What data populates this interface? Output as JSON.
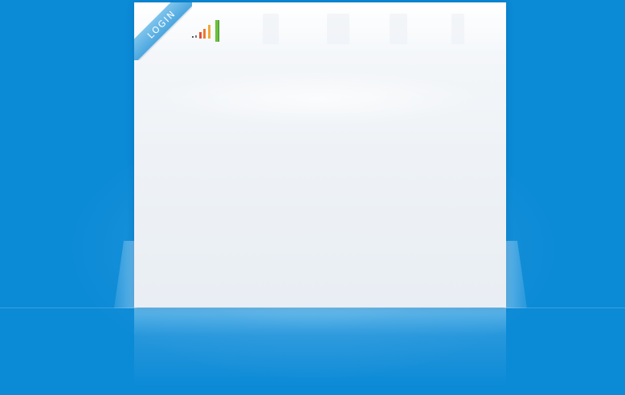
{
  "page": {
    "ribbon_label": "LOGIN"
  },
  "colors": {
    "background": "#0b8ad6",
    "card": "#eef2f6",
    "ribbon": "#4aa6df",
    "logo_bars": [
      "#e0533b",
      "#ef7a2f",
      "#f2a93b",
      "#6cbf3f"
    ]
  },
  "icons": {
    "logo": "signal-bars-icon"
  }
}
